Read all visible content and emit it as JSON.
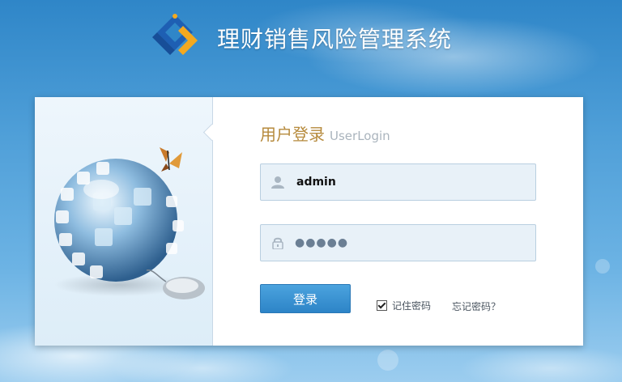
{
  "header": {
    "app_title": "理财销售风险管理系统"
  },
  "login": {
    "heading_cn": "用户登录",
    "heading_en": "UserLogin",
    "username_value": "admin",
    "password_masked": "●●●●●",
    "login_button": "登录",
    "remember_label": "记住密码",
    "remember_checked": true,
    "forgot_link": "忘记密码？"
  },
  "icons": {
    "logo": "app-logo",
    "user": "user-icon",
    "lock": "lock-icon",
    "art": "globe-puzzle-illustration"
  },
  "colors": {
    "heading": "#b68a3c",
    "button": "#2d84c7",
    "field_bg": "#e8f1f8",
    "sky": "#4f9fd8"
  }
}
